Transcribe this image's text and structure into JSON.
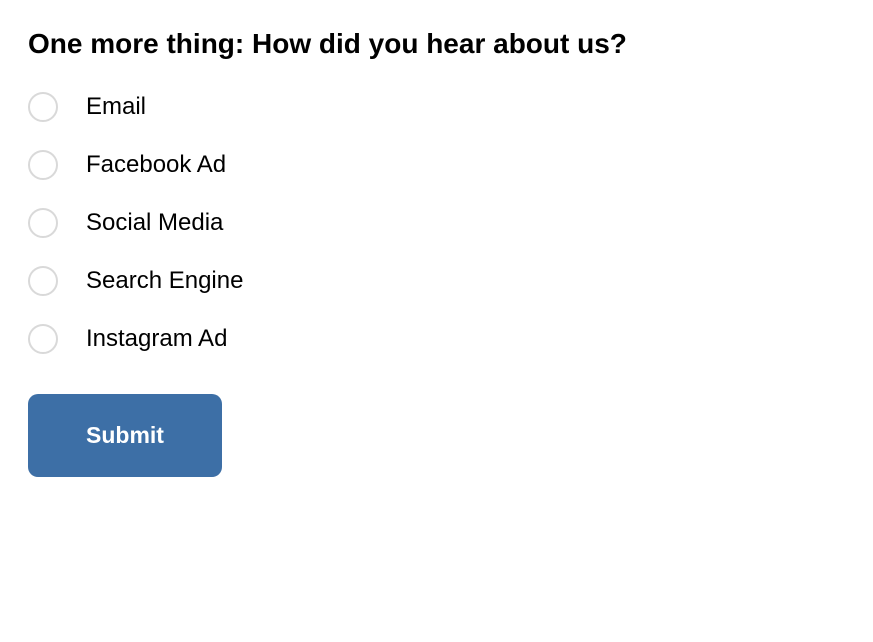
{
  "question": "One more thing: How did you hear about us?",
  "options": [
    {
      "label": "Email"
    },
    {
      "label": "Facebook Ad"
    },
    {
      "label": "Social Media"
    },
    {
      "label": "Search Engine"
    },
    {
      "label": "Instagram Ad"
    }
  ],
  "submit_label": "Submit"
}
